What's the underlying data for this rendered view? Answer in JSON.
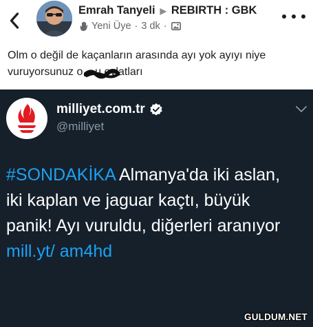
{
  "post": {
    "author": "Emrah Tanyeli",
    "group": "REBIRTH : GBK",
    "member_badge": "Yeni Üye",
    "time": "3 dk",
    "caption_prefix": "Olm o değil de kaçanların arasında ayı yok ayıyı niye vuruyorsunuz ",
    "caption_censored": "o....u",
    "caption_suffix": " evlatları",
    "icons": {
      "back": "chevron-left-icon",
      "wave": "waving-hand-icon",
      "audience": "photo-audience-icon",
      "more": "more-dots-icon"
    }
  },
  "tweet": {
    "display_name": "milliyet.com.tr",
    "handle": "@milliyet",
    "hashtag": "#SONDAKİKA",
    "text_main": " Almanya'da iki aslan, iki kaplan ve jaguar kaçtı, büyük panik! Ayı vuruldu, diğerleri aranıyor ",
    "link_text": "mill.yt/ am4hd",
    "colors": {
      "background": "#15202b",
      "link": "#1da1f2",
      "muted": "#8899a6",
      "logo_red": "#e11b22"
    },
    "icons": {
      "logo": "milliyet-flame-logo",
      "verified": "verified-badge-icon",
      "caret": "chevron-down-icon"
    }
  },
  "watermark": "GULDUM.NET"
}
